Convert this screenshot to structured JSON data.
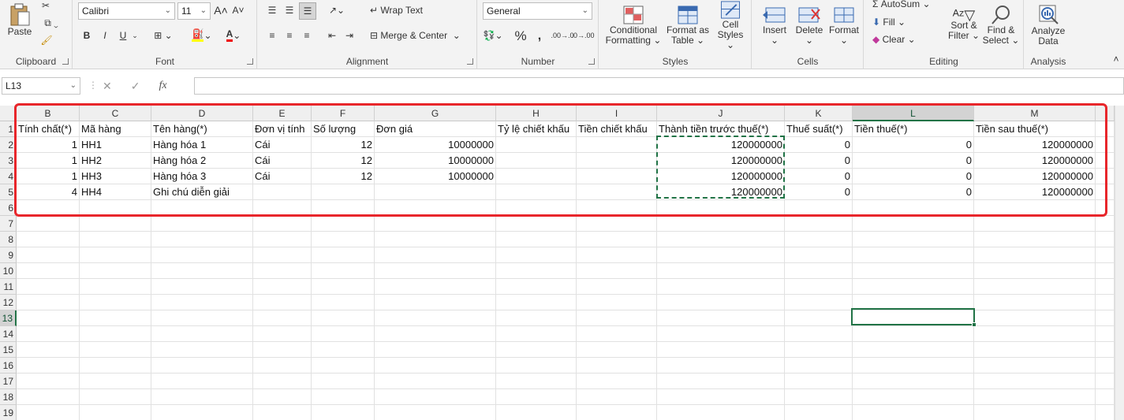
{
  "clipboard": {
    "paste": "Paste",
    "label": "Clipboard"
  },
  "font": {
    "name": "Calibri",
    "size": "11",
    "label": "Font",
    "bold": "B",
    "italic": "I",
    "underline": "U"
  },
  "alignment": {
    "wrap": "Wrap Text",
    "merge": "Merge & Center",
    "label": "Alignment"
  },
  "number": {
    "format": "General",
    "percent": "%",
    "comma": ",",
    "inc_dec": ".00→.0",
    "dec_dec": ".0→.00",
    "label": "Number"
  },
  "styles": {
    "cond1": "Conditional",
    "cond2": "Formatting",
    "fmt1": "Format as",
    "fmt2": "Table",
    "cell1": "Cell",
    "cell2": "Styles",
    "label": "Styles"
  },
  "cells": {
    "insert": "Insert",
    "delete": "Delete",
    "format": "Format",
    "label": "Cells"
  },
  "editing": {
    "autosum": "AutoSum",
    "fill": "Fill",
    "clear": "Clear",
    "sort1": "Sort &",
    "sort2": "Filter",
    "find1": "Find &",
    "find2": "Select",
    "label": "Editing"
  },
  "analysis": {
    "analyze1": "Analyze",
    "analyze2": "Data",
    "label": "Analysis"
  },
  "formula_bar": {
    "name_box": "L13",
    "fx": "fx",
    "value": ""
  },
  "sheet": {
    "columns": [
      "B",
      "C",
      "D",
      "E",
      "F",
      "G",
      "H",
      "I",
      "J",
      "K",
      "L",
      "M"
    ],
    "selected_column": "L",
    "rows": [
      "1",
      "2",
      "3",
      "4",
      "5",
      "6",
      "7",
      "8",
      "9",
      "10",
      "11",
      "12",
      "13",
      "14",
      "15",
      "16",
      "17",
      "18",
      "19"
    ],
    "selected_row": "13",
    "header": [
      "Tính chất(*)",
      "Mã hàng",
      "Tên hàng(*)",
      "Đơn vị tính",
      "Số lượng",
      "Đơn giá",
      "Tỷ lệ chiết khấu",
      "Tiền chiết khấu",
      "Thành tiền trước thuế(*)",
      "Thuế suất(*)",
      "Tiền thuế(*)",
      "Tiền sau thuế(*)"
    ],
    "data": [
      [
        "1",
        "HH1",
        "Hàng hóa 1",
        "Cái",
        "12",
        "10000000",
        "",
        "",
        "120000000",
        "0",
        "0",
        "120000000"
      ],
      [
        "1",
        "HH2",
        "Hàng hóa 2",
        "Cái",
        "12",
        "10000000",
        "",
        "",
        "120000000",
        "0",
        "0",
        "120000000"
      ],
      [
        "1",
        "HH3",
        "Hàng hóa 3",
        "Cái",
        "12",
        "10000000",
        "",
        "",
        "120000000",
        "0",
        "0",
        "120000000"
      ],
      [
        "4",
        "HH4",
        "Ghi chú diễn giải",
        "",
        "",
        "",
        "",
        "",
        "120000000",
        "0",
        "0",
        "120000000"
      ]
    ]
  },
  "colors": {
    "accent": "#217346",
    "highlight_border": "#e8262b"
  }
}
